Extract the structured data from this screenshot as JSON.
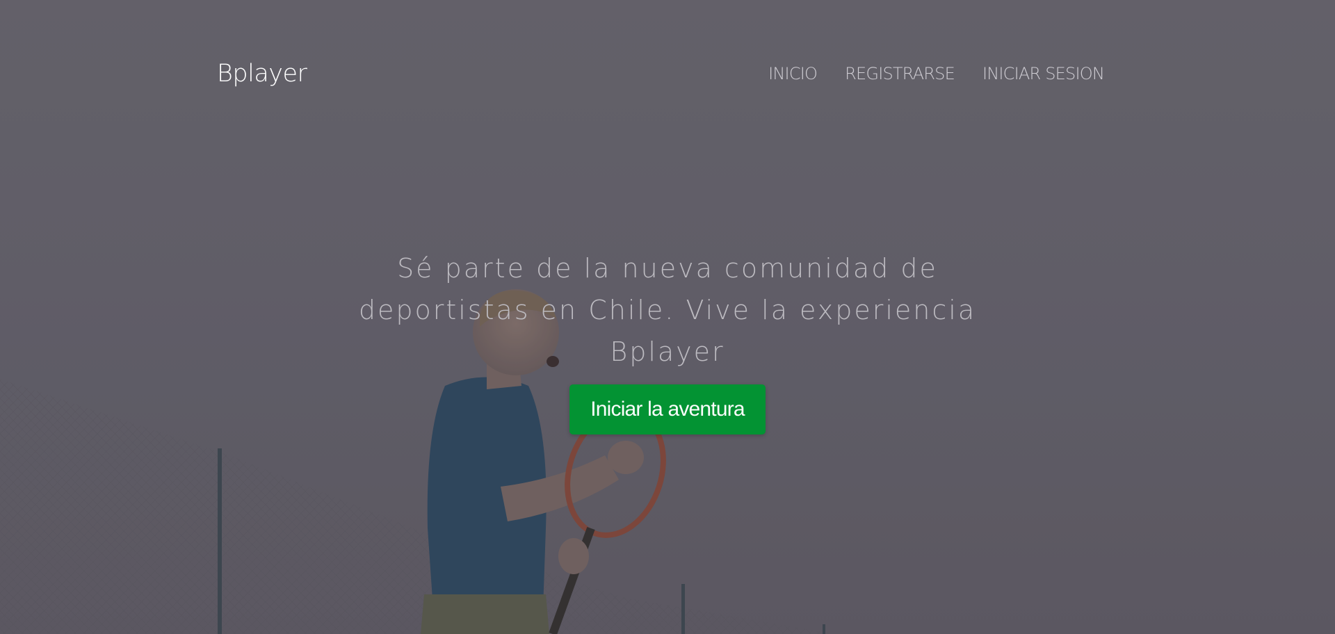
{
  "brand": "Bplayer",
  "nav": {
    "items": [
      {
        "label": "INICIO"
      },
      {
        "label": "REGISTRARSE"
      },
      {
        "label": "INICIAR SESION"
      }
    ]
  },
  "hero": {
    "tagline_line1": "Sé parte de la nueva comunidad de",
    "tagline_line2": "deportistas en Chile. Vive la experiencia",
    "tagline_line3": "Bplayer",
    "cta_label": "Iniciar la aventura"
  },
  "colors": {
    "cta_background": "#039333",
    "overlay": "#67646c",
    "nav_text": "#cfcdd3"
  }
}
